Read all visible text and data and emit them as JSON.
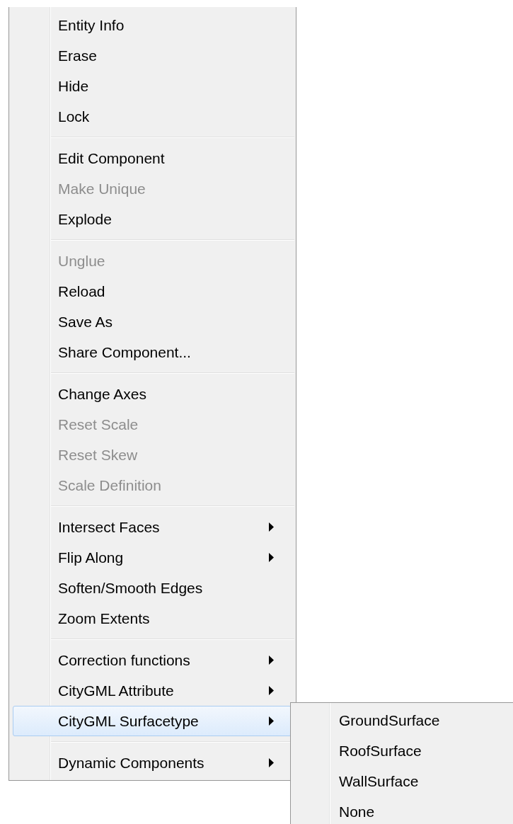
{
  "menu": {
    "groups": [
      {
        "items": [
          {
            "label": "Entity Info",
            "disabled": false,
            "submenu": false,
            "selected": false
          },
          {
            "label": "Erase",
            "disabled": false,
            "submenu": false,
            "selected": false
          },
          {
            "label": "Hide",
            "disabled": false,
            "submenu": false,
            "selected": false
          },
          {
            "label": "Lock",
            "disabled": false,
            "submenu": false,
            "selected": false
          }
        ]
      },
      {
        "items": [
          {
            "label": "Edit Component",
            "disabled": false,
            "submenu": false,
            "selected": false
          },
          {
            "label": "Make Unique",
            "disabled": true,
            "submenu": false,
            "selected": false
          },
          {
            "label": "Explode",
            "disabled": false,
            "submenu": false,
            "selected": false
          }
        ]
      },
      {
        "items": [
          {
            "label": "Unglue",
            "disabled": true,
            "submenu": false,
            "selected": false
          },
          {
            "label": "Reload",
            "disabled": false,
            "submenu": false,
            "selected": false
          },
          {
            "label": "Save As",
            "disabled": false,
            "submenu": false,
            "selected": false
          },
          {
            "label": "Share Component...",
            "disabled": false,
            "submenu": false,
            "selected": false
          }
        ]
      },
      {
        "items": [
          {
            "label": "Change Axes",
            "disabled": false,
            "submenu": false,
            "selected": false
          },
          {
            "label": "Reset Scale",
            "disabled": true,
            "submenu": false,
            "selected": false
          },
          {
            "label": "Reset Skew",
            "disabled": true,
            "submenu": false,
            "selected": false
          },
          {
            "label": "Scale Definition",
            "disabled": true,
            "submenu": false,
            "selected": false
          }
        ]
      },
      {
        "items": [
          {
            "label": "Intersect Faces",
            "disabled": false,
            "submenu": true,
            "selected": false
          },
          {
            "label": "Flip Along",
            "disabled": false,
            "submenu": true,
            "selected": false
          },
          {
            "label": "Soften/Smooth Edges",
            "disabled": false,
            "submenu": false,
            "selected": false
          },
          {
            "label": "Zoom Extents",
            "disabled": false,
            "submenu": false,
            "selected": false
          }
        ]
      },
      {
        "items": [
          {
            "label": "Correction functions",
            "disabled": false,
            "submenu": true,
            "selected": false
          },
          {
            "label": "CityGML Attribute",
            "disabled": false,
            "submenu": true,
            "selected": false
          },
          {
            "label": "CityGML Surfacetype",
            "disabled": false,
            "submenu": true,
            "selected": true
          }
        ]
      },
      {
        "items": [
          {
            "label": "Dynamic Components",
            "disabled": false,
            "submenu": true,
            "selected": false
          }
        ]
      }
    ]
  },
  "submenu": {
    "items": [
      {
        "label": "GroundSurface",
        "selected": false
      },
      {
        "label": "RoofSurface",
        "selected": false
      },
      {
        "label": "WallSurface",
        "selected": false
      },
      {
        "label": "None",
        "selected": false
      }
    ]
  }
}
